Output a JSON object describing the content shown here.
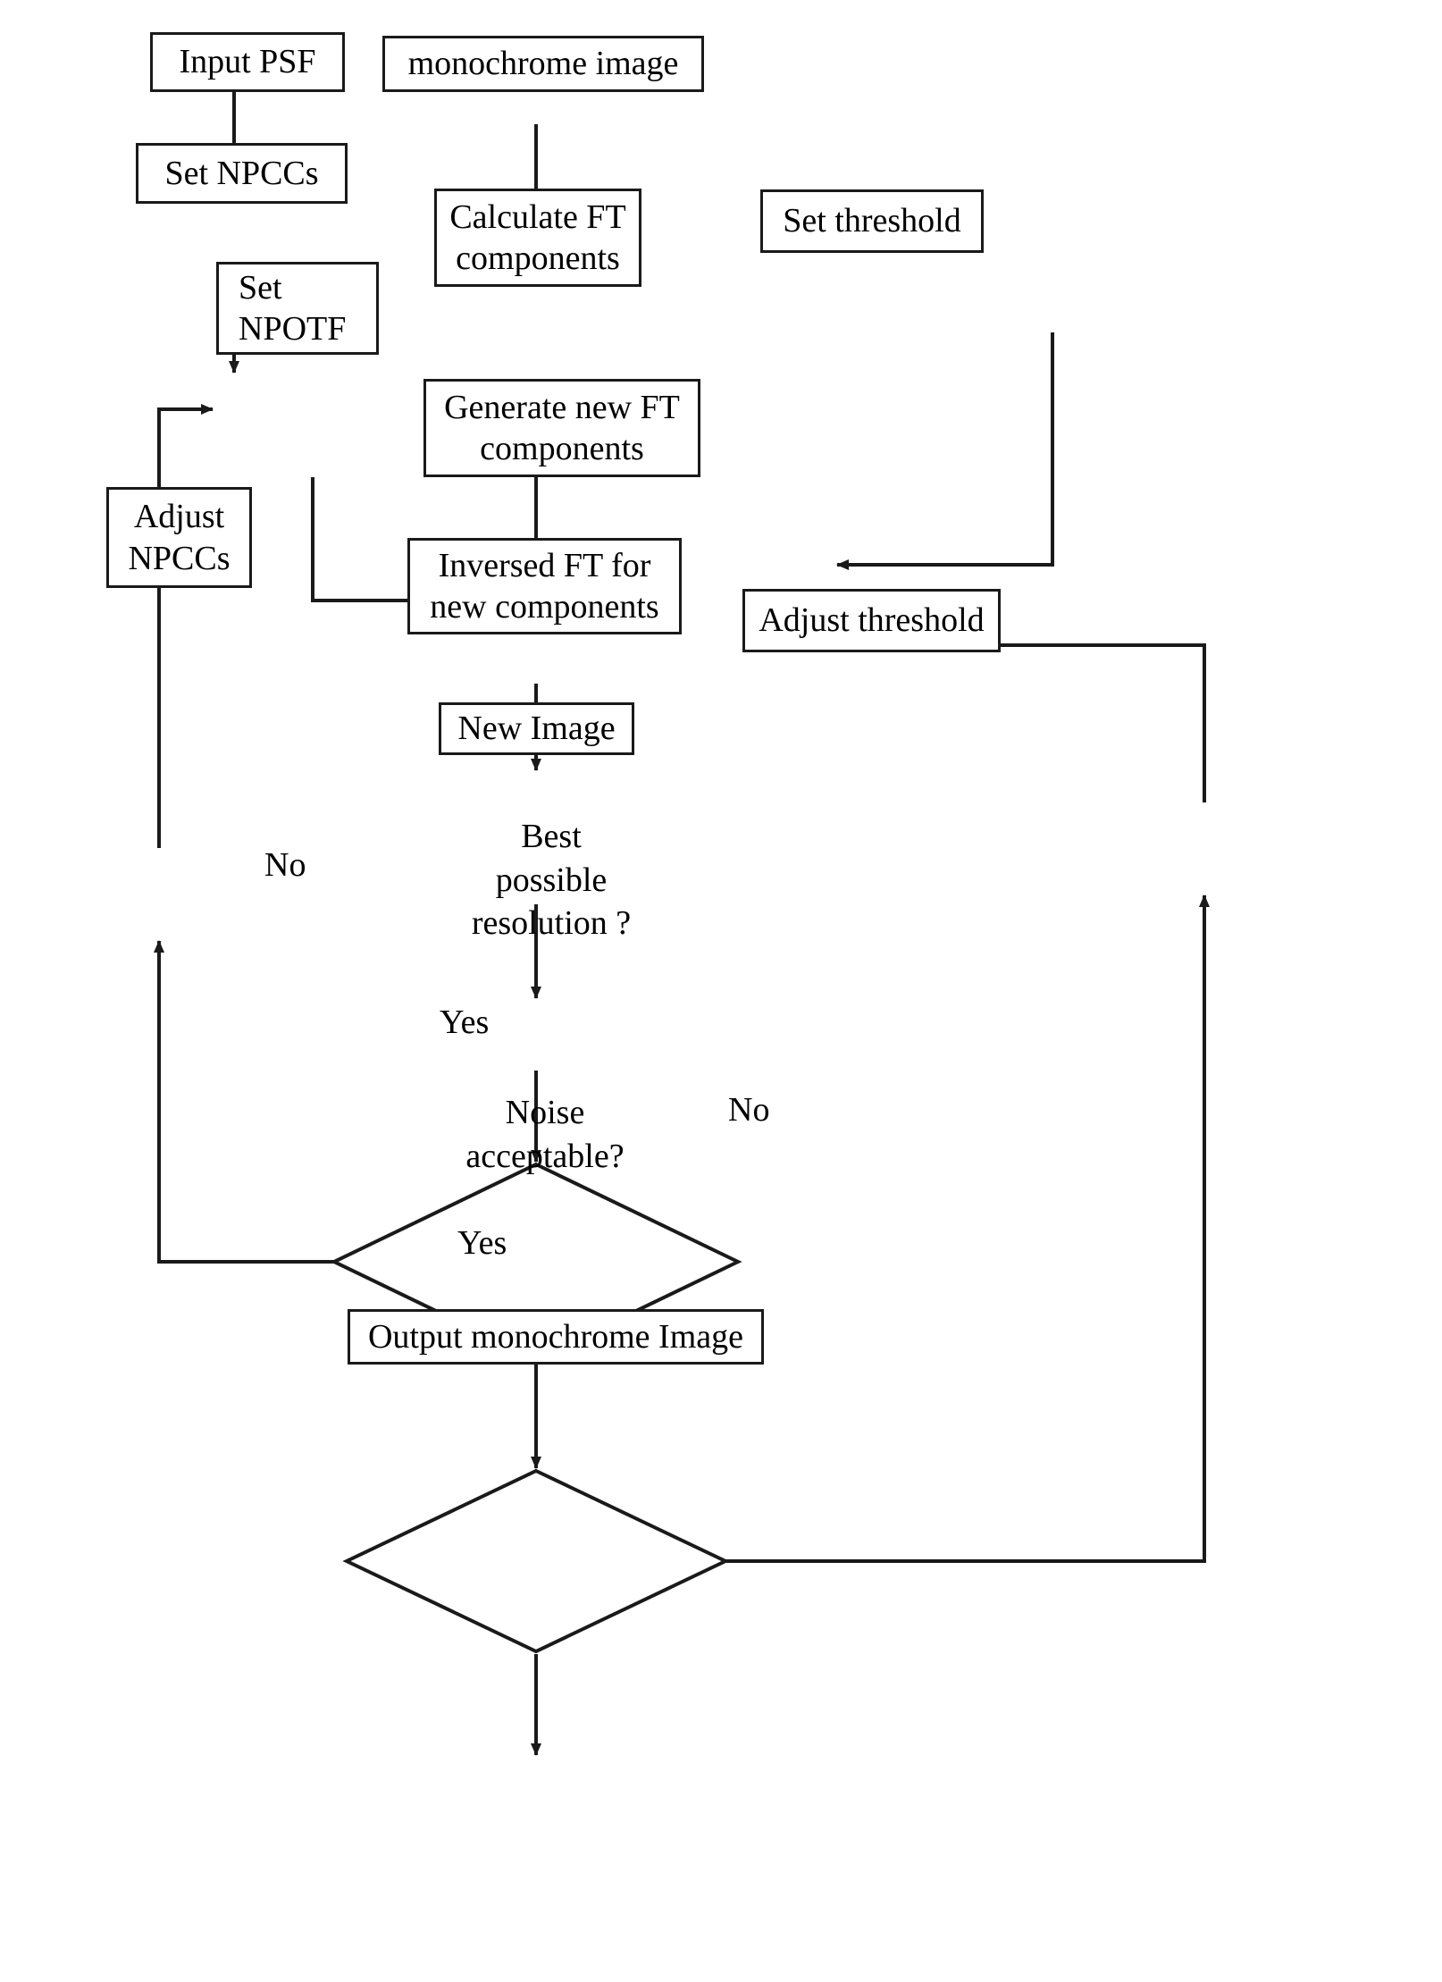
{
  "diagram": {
    "title": "Image deconvolution flowchart",
    "stroke_color": "#1a1a1a",
    "background_color": "#ffffff",
    "nodes": [
      {
        "id": "input_psf",
        "shape": "box",
        "label": "Input PSF"
      },
      {
        "id": "monochrome_image",
        "shape": "box",
        "label": "monochrome image"
      },
      {
        "id": "set_npccs",
        "shape": "box",
        "label": "Set NPCCs"
      },
      {
        "id": "calculate_ft",
        "shape": "box",
        "label": "Calculate FT\ncomponents"
      },
      {
        "id": "set_threshold",
        "shape": "box",
        "label": "Set threshold"
      },
      {
        "id": "set_npotf",
        "shape": "box",
        "label": "Set\nNPOTF"
      },
      {
        "id": "generate_new_ft",
        "shape": "box",
        "label": "Generate new FT\ncomponents"
      },
      {
        "id": "adjust_npccs",
        "shape": "box",
        "label": "Adjust\nNPCCs"
      },
      {
        "id": "inversed_ft",
        "shape": "box",
        "label": "Inversed FT for\nnew components"
      },
      {
        "id": "adjust_threshold",
        "shape": "box",
        "label": "Adjust threshold"
      },
      {
        "id": "new_image",
        "shape": "box",
        "label": "New Image"
      },
      {
        "id": "best_resolution",
        "shape": "diamond",
        "label": "Best\npossible\nresolution ?"
      },
      {
        "id": "noise_acceptable",
        "shape": "diamond",
        "label": "Noise\nacceptable?"
      },
      {
        "id": "output_image",
        "shape": "box",
        "label": "Output  monochrome Image"
      }
    ],
    "edge_labels": [
      {
        "id": "no_resolution",
        "label": "No"
      },
      {
        "id": "yes_resolution",
        "label": "Yes"
      },
      {
        "id": "no_noise",
        "label": "No"
      },
      {
        "id": "yes_noise",
        "label": "Yes"
      }
    ]
  }
}
